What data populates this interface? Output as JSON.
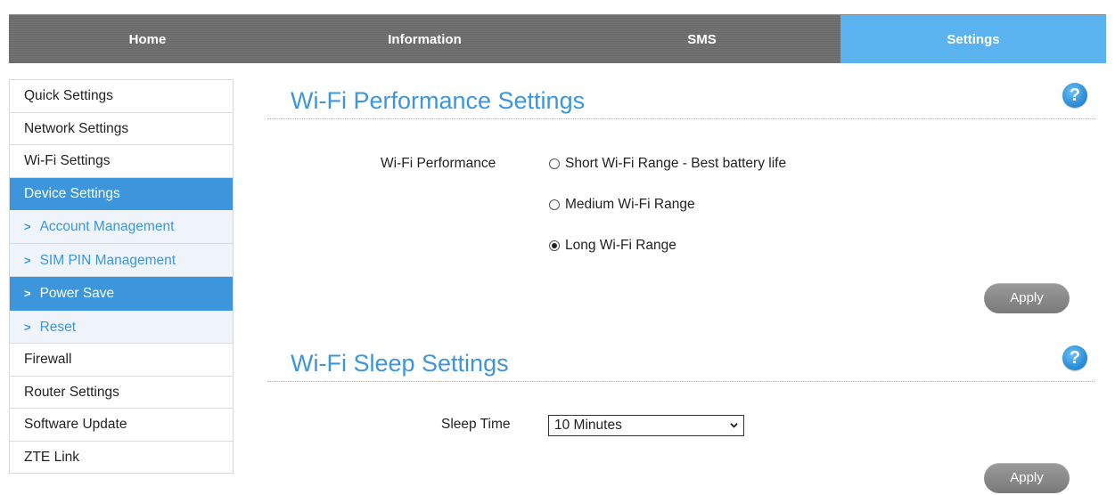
{
  "nav": {
    "tabs": [
      {
        "label": "Home"
      },
      {
        "label": "Information"
      },
      {
        "label": "SMS"
      },
      {
        "label": "Settings"
      }
    ],
    "active_color": "#5ab3ee"
  },
  "sidebar": {
    "items": [
      {
        "label": "Quick Settings"
      },
      {
        "label": "Network Settings"
      },
      {
        "label": "Wi-Fi Settings"
      },
      {
        "label": "Device Settings"
      },
      {
        "label": "Account Management"
      },
      {
        "label": "SIM PIN Management"
      },
      {
        "label": "Power Save"
      },
      {
        "label": "Reset"
      },
      {
        "label": "Firewall"
      },
      {
        "label": "Router Settings"
      },
      {
        "label": "Software Update"
      },
      {
        "label": "ZTE Link"
      }
    ],
    "active_color": "#3d95db"
  },
  "performance": {
    "title": "Wi-Fi Performance Settings",
    "field_label": "Wi-Fi Performance",
    "options": [
      {
        "label": "Short Wi-Fi Range - Best battery life",
        "checked": false
      },
      {
        "label": "Medium Wi-Fi Range",
        "checked": false
      },
      {
        "label": "Long Wi-Fi Range",
        "checked": true
      }
    ],
    "apply_label": "Apply",
    "help_icon": "question-mark-icon"
  },
  "sleep": {
    "title": "Wi-Fi Sleep Settings",
    "field_label": "Sleep Time",
    "selected": "10 Minutes",
    "apply_label": "Apply",
    "help_icon": "question-mark-icon"
  }
}
